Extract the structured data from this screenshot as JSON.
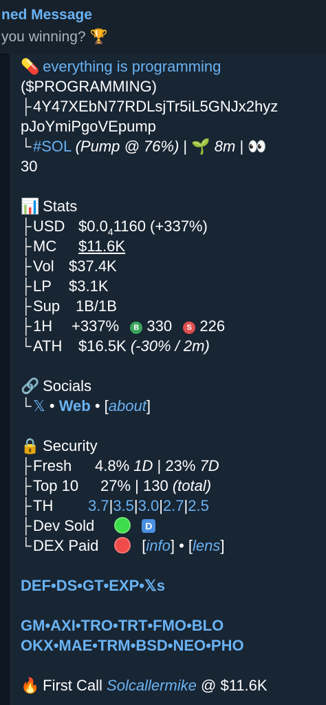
{
  "pinned": {
    "title": "ned Message",
    "preview": " you winning?",
    "trophy_icon": "🏆"
  },
  "token": {
    "pill_icon": "💊",
    "name": "everything is programming",
    "ticker": "($PROGRAMMING)",
    "address_line1": "4Y47XEbN77RDLsjTr5iL5GNJx2hyz",
    "address_line2": "pJoYmiPgoVEpump",
    "chain_tag": "#SOL",
    "platform": "(Pump @ 76%)",
    "sep": "|",
    "sprout_icon": "🌱",
    "age": "8m",
    "eyes_icon": "👀",
    "watchers": "30"
  },
  "stats": {
    "icon": "📊",
    "title": "Stats",
    "usd_label": "USD",
    "usd_value": "$0.0",
    "usd_sub": "4",
    "usd_rest": "1160 (+337%)",
    "mc_label": "MC",
    "mc_value": "$11.6K",
    "vol_label": "Vol",
    "vol_value": "$37.4K",
    "lp_label": "LP",
    "lp_value": "$3.1K",
    "sup_label": "Sup",
    "sup_value": "1B/1B",
    "h1_label": "1H",
    "h1_change": "+337%",
    "buy_badge": "B",
    "buys": "330",
    "sell_badge": "S",
    "sells": "226",
    "ath_label": "ATH",
    "ath_value": "$16.5K",
    "ath_note": "(-30% / 2m)",
    "buy_color": "#3ba55c",
    "sell_color": "#e0504f"
  },
  "socials": {
    "icon": "🔗",
    "title": "Socials",
    "x": "𝕏",
    "dot": "•",
    "web": "Web",
    "about": "about"
  },
  "security": {
    "icon": "🔒",
    "title": "Security",
    "fresh_label": "Fresh",
    "fresh_1d": "4.8%",
    "fresh_1d_unit": "1D",
    "fresh_7d": "23%",
    "fresh_7d_unit": "7D",
    "top10_label": "Top 10",
    "top10_pct": "27%",
    "top10_count": "130",
    "top10_note": "(total)",
    "th_label": "TH",
    "th_values": [
      "3.7",
      "3.5",
      "3.0",
      "2.7",
      "2.5"
    ],
    "devsold_label": "Dev Sold",
    "devsold_badge": "D",
    "dexpaid_label": "DEX Paid",
    "info": "info",
    "lens": "lens",
    "green": "#3ddc4a",
    "red": "#f04b4b"
  },
  "links_row1": [
    "DEF",
    "DS",
    "GT",
    "EXP",
    "𝕏s"
  ],
  "links_row2": [
    "GM",
    "AXI",
    "TRO",
    "TRT",
    "FMO",
    "BLO"
  ],
  "links_row3": [
    "OKX",
    "MAE",
    "TRM",
    "BSD",
    "NEO",
    "PHO"
  ],
  "first_call": {
    "icon": "🔥",
    "label": "First Call",
    "user": "Solcallermike",
    "at": "@",
    "value": "$11.6K"
  },
  "colors": {
    "background": "#0e1621",
    "bubble": "#182533",
    "link": "#6ab3f3"
  }
}
